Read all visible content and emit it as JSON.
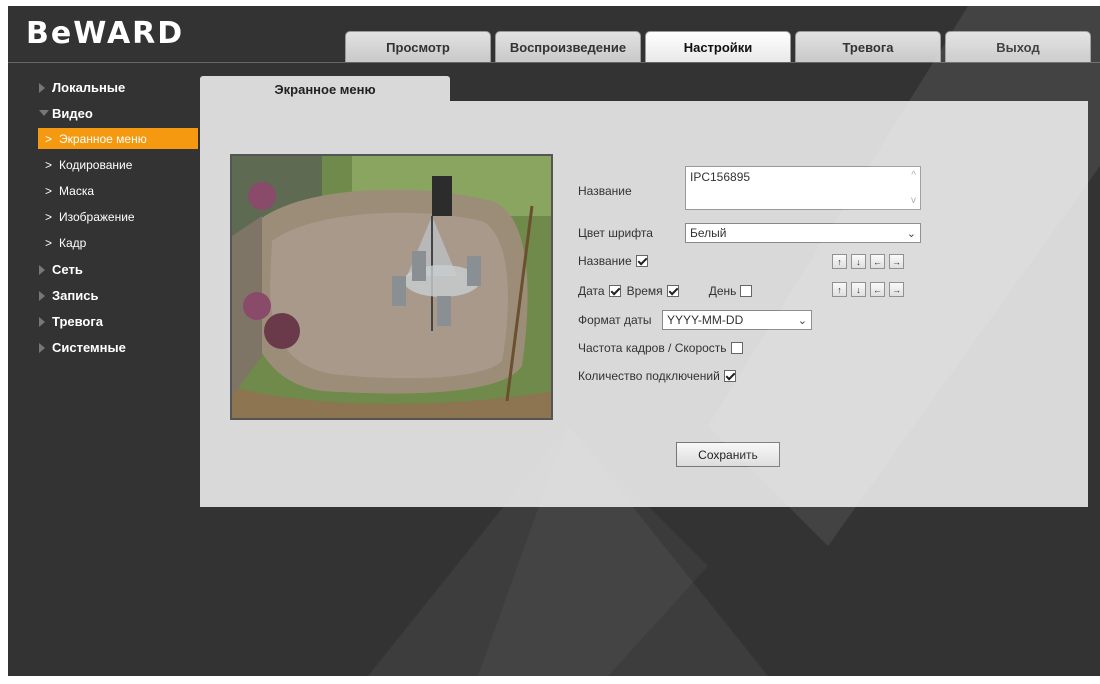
{
  "brand": {
    "logo_text": "BeWARD"
  },
  "tabs": [
    {
      "label": "Просмотр",
      "active": false
    },
    {
      "label": "Воспроизведение",
      "active": false
    },
    {
      "label": "Настройки",
      "active": true
    },
    {
      "label": "Тревога",
      "active": false
    },
    {
      "label": "Выход",
      "active": false
    }
  ],
  "sidebar": {
    "local": "Локальные",
    "video": "Видео",
    "video_items": [
      "Экранное меню",
      "Кодирование",
      "Маска",
      "Изображение",
      "Кадр"
    ],
    "network": "Сеть",
    "record": "Запись",
    "alarm": "Тревога",
    "system": "Системные"
  },
  "section_title": "Экранное меню",
  "form": {
    "name_label": "Название",
    "name_value": "IPC156895",
    "font_color_label": "Цвет шрифта",
    "font_color_value": "Белый",
    "name_show_label": "Название",
    "name_show_checked": true,
    "date_label": "Дата",
    "date_checked": true,
    "time_label": "Время",
    "time_checked": true,
    "day_label": "День",
    "day_checked": false,
    "date_format_label": "Формат даты",
    "date_format_value": "YYYY-MM-DD",
    "fps_label": "Частота кадров / Скорость",
    "fps_checked": false,
    "connections_label": "Количество подключений",
    "connections_checked": true,
    "save_label": "Сохранить",
    "arrow_icons": [
      "↑",
      "↓",
      "←",
      "→"
    ]
  },
  "colors": {
    "accent": "#f59a10",
    "background": "#333333",
    "panel": "#d9d9d9"
  }
}
